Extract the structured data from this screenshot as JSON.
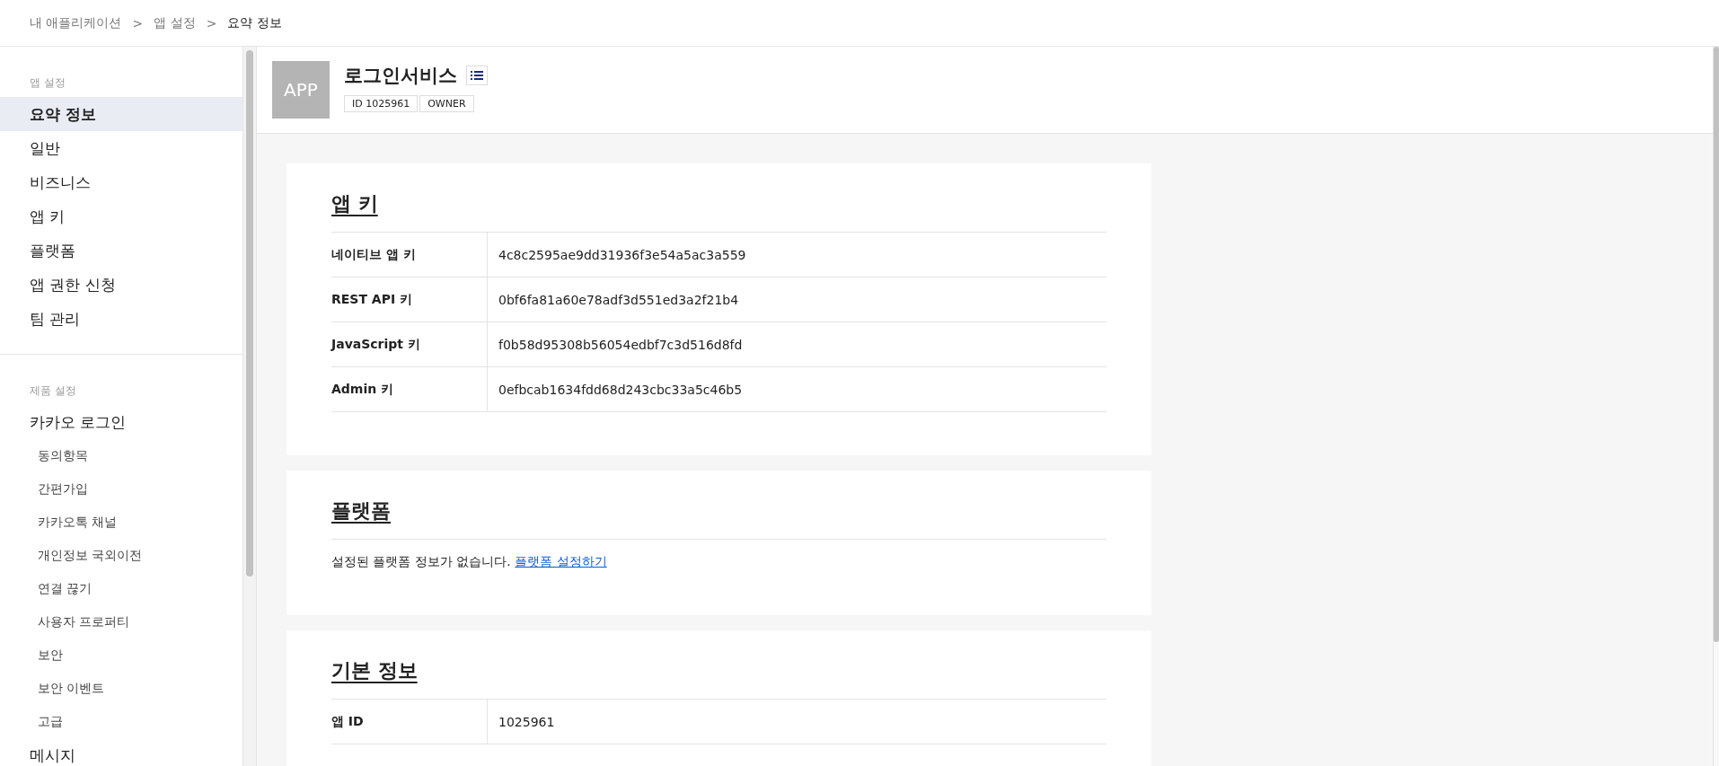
{
  "breadcrumb": [
    {
      "kind": "crumb",
      "label": "내 애플리케이션",
      "current": false
    },
    {
      "kind": "separator",
      "label": ">"
    },
    {
      "kind": "crumb",
      "label": "앱 설정",
      "current": false
    },
    {
      "kind": "separator",
      "label": ">"
    },
    {
      "kind": "crumb",
      "label": "요약 정보",
      "current": true
    }
  ],
  "sidebar": {
    "sections": [
      {
        "title": "앱 설정",
        "items": [
          {
            "label": "요약 정보",
            "selected": true
          },
          {
            "label": "일반",
            "selected": false
          },
          {
            "label": "비즈니스",
            "selected": false
          },
          {
            "label": "앱 키",
            "selected": false
          },
          {
            "label": "플랫폼",
            "selected": false
          },
          {
            "label": "앱 권한 신청",
            "selected": false
          },
          {
            "label": "팀 관리",
            "selected": false
          }
        ]
      },
      {
        "title": "제품 설정",
        "items": [
          {
            "label": "카카오 로그인",
            "selected": false,
            "children": [
              {
                "label": "동의항목",
                "selected": false
              },
              {
                "label": "간편가입",
                "selected": false
              },
              {
                "label": "카카오톡 채널",
                "selected": false
              },
              {
                "label": "개인정보 국외이전",
                "selected": false
              },
              {
                "label": "연결 끊기",
                "selected": false
              },
              {
                "label": "사용자 프로퍼티",
                "selected": false
              },
              {
                "label": "보안",
                "selected": false
              },
              {
                "label": "보안 이벤트",
                "selected": false
              },
              {
                "label": "고급",
                "selected": false
              }
            ]
          },
          {
            "label": "메시지",
            "selected": false
          }
        ]
      }
    ]
  },
  "app": {
    "icon_text": "APP",
    "name": "로그인서비스",
    "badges": [
      "ID 1025961",
      "OWNER"
    ]
  },
  "cards": [
    {
      "kind": "table",
      "title": "앱 키",
      "rows": [
        {
          "label": "네이티브 앱 키",
          "value": "4c8c2595ae9dd31936f3e54a5ac3a559"
        },
        {
          "label": "REST API 키",
          "value": "0bf6fa81a60e78adf3d551ed3a2f21b4"
        },
        {
          "label": "JavaScript 키",
          "value": "f0b58d95308b56054edbf7c3d516d8fd"
        },
        {
          "label": "Admin 키",
          "value": "0efbcab1634fdd68d243cbc33a5c46b5"
        }
      ]
    },
    {
      "kind": "message",
      "title": "플랫폼",
      "text": "설정된 플랫폼 정보가 없습니다.",
      "link": "플랫폼 설정하기"
    },
    {
      "kind": "table",
      "title": "기본 정보",
      "rows": [
        {
          "label": "앱 ID",
          "value": "1025961"
        }
      ]
    }
  ]
}
